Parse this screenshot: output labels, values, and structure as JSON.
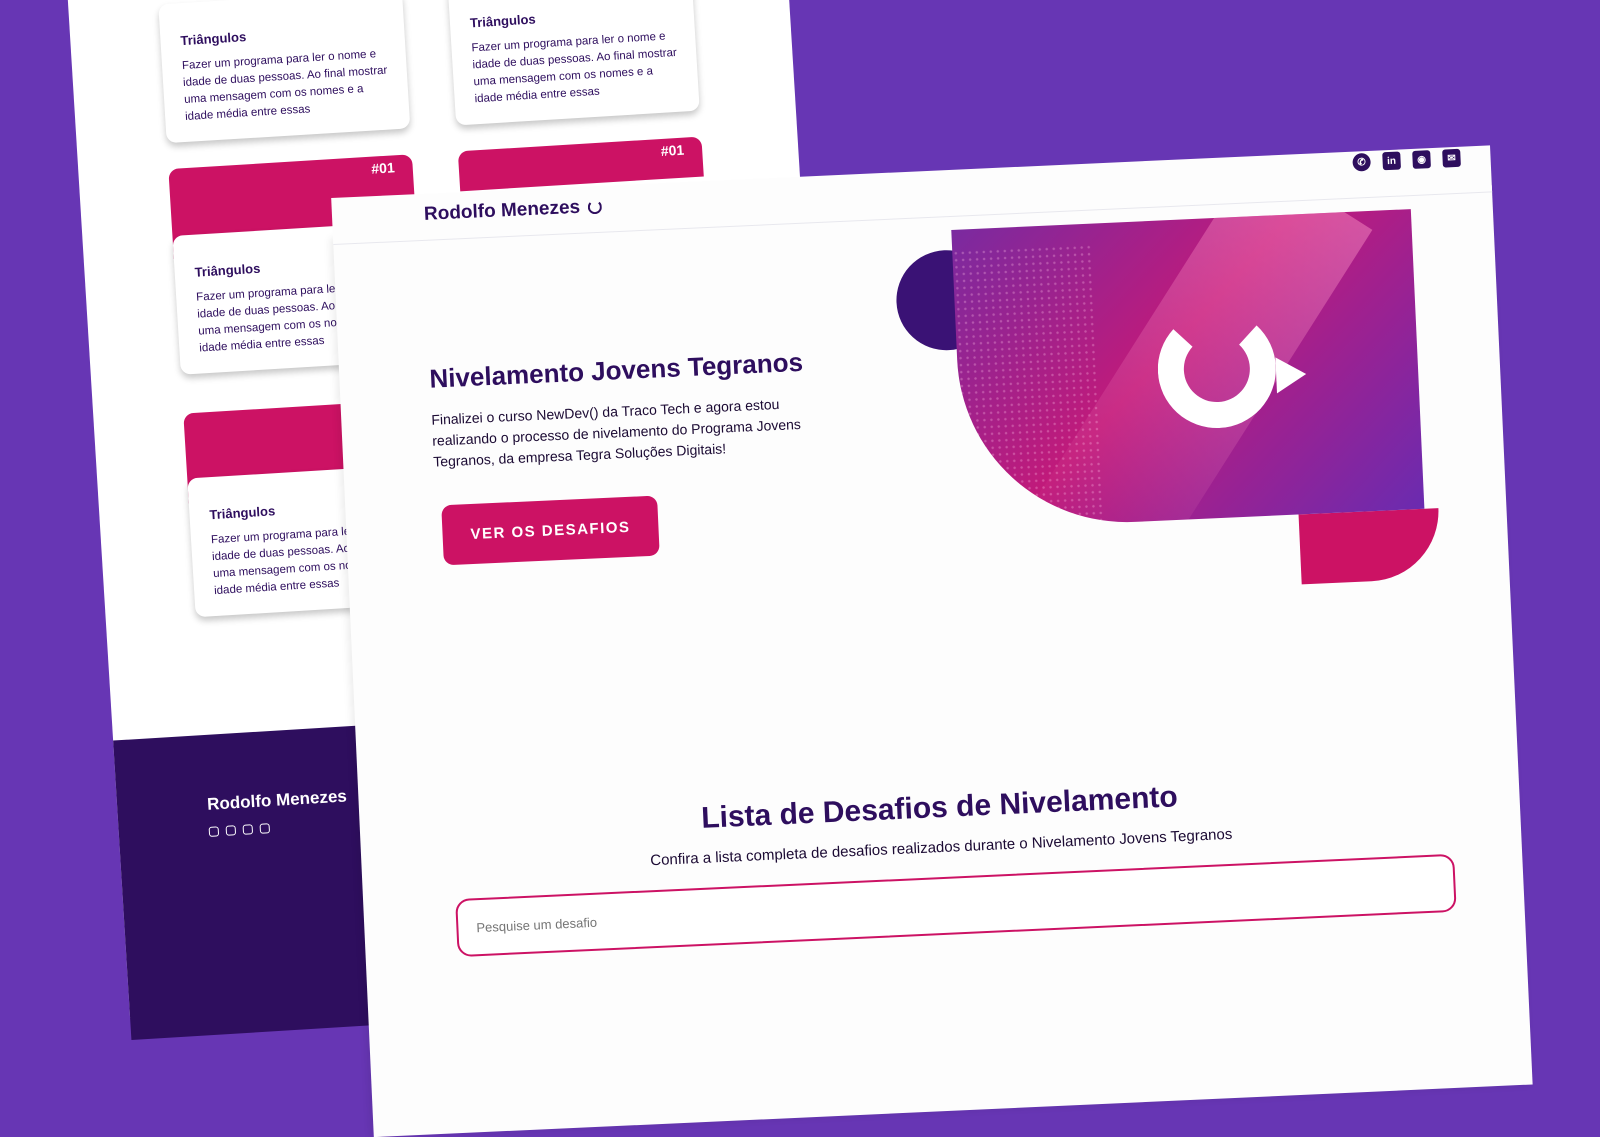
{
  "back_sheet": {
    "cards": [
      {
        "number": "",
        "title": "Triângulos",
        "text": "Fazer um programa para ler o nome e idade de duas pessoas. Ao final mostrar uma mensagem com os nomes e a idade média entre essas"
      },
      {
        "number": "",
        "title": "Triângulos",
        "text": "Fazer um programa para ler o nome e idade de duas pessoas. Ao final mostrar uma mensagem com os nomes e a idade média entre essas"
      },
      {
        "number": "#01",
        "title": "Triângulos",
        "text": "Fazer um programa para ler o nome e idade de duas pessoas. Ao final mostrar uma mensagem com os nomes e a idade média entre essas"
      },
      {
        "number": "#01",
        "title": "",
        "text": ""
      },
      {
        "number": "",
        "title": "Triângulos",
        "text": "Fazer um programa para ler o nome e idade de duas pessoas. Ao final mostrar uma mensagem com os nomes e a idade média entre essas"
      }
    ],
    "footer_brand": "Rodolfo Menezes"
  },
  "header": {
    "brand": "Rodolfo Menezes",
    "social_icons": [
      "whatsapp-icon",
      "linkedin-icon",
      "github-icon",
      "mail-icon"
    ]
  },
  "hero": {
    "title": "Nivelamento Jovens Tegranos",
    "text": "Finalizei o curso NewDev() da Traco Tech e agora estou realizando o processo de nivelamento do Programa Jovens Tegranos, da empresa Tegra Soluções Digitais!",
    "button": "VER OS DESAFIOS"
  },
  "list": {
    "title": "Lista de Desafios de Nivelamento",
    "subtitle": "Confira a lista completa de desafios realizados durante o Nivelamento Jovens Tegranos",
    "search_placeholder": "Pesquise um desafio"
  },
  "colors": {
    "background": "#6736b4",
    "dark_purple": "#2e0e5e",
    "accent_pink": "#cc1264"
  }
}
